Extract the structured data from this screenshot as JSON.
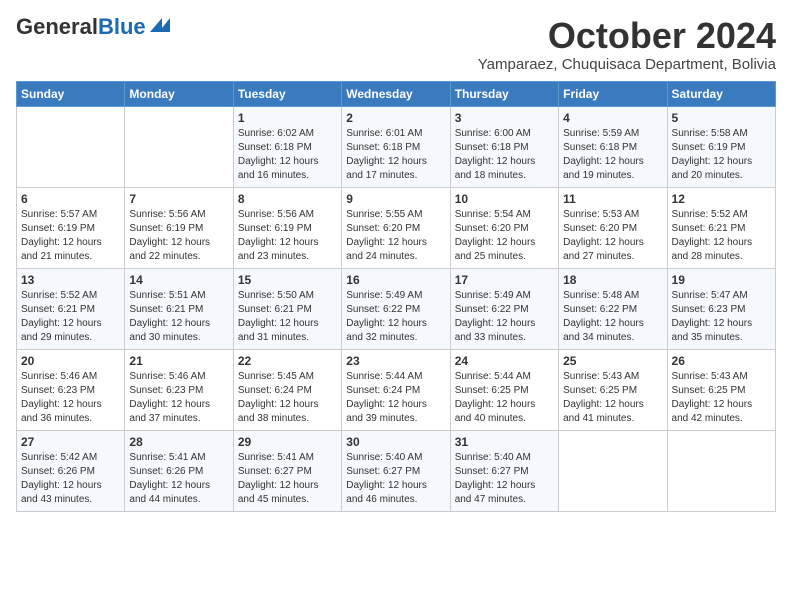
{
  "logo": {
    "part1": "General",
    "part2": "Blue"
  },
  "title": "October 2024",
  "subtitle": "Yamparaez, Chuquisaca Department, Bolivia",
  "days_of_week": [
    "Sunday",
    "Monday",
    "Tuesday",
    "Wednesday",
    "Thursday",
    "Friday",
    "Saturday"
  ],
  "weeks": [
    [
      {
        "day": "",
        "info": ""
      },
      {
        "day": "",
        "info": ""
      },
      {
        "day": "1",
        "info": "Sunrise: 6:02 AM\nSunset: 6:18 PM\nDaylight: 12 hours and 16 minutes."
      },
      {
        "day": "2",
        "info": "Sunrise: 6:01 AM\nSunset: 6:18 PM\nDaylight: 12 hours and 17 minutes."
      },
      {
        "day": "3",
        "info": "Sunrise: 6:00 AM\nSunset: 6:18 PM\nDaylight: 12 hours and 18 minutes."
      },
      {
        "day": "4",
        "info": "Sunrise: 5:59 AM\nSunset: 6:18 PM\nDaylight: 12 hours and 19 minutes."
      },
      {
        "day": "5",
        "info": "Sunrise: 5:58 AM\nSunset: 6:19 PM\nDaylight: 12 hours and 20 minutes."
      }
    ],
    [
      {
        "day": "6",
        "info": "Sunrise: 5:57 AM\nSunset: 6:19 PM\nDaylight: 12 hours and 21 minutes."
      },
      {
        "day": "7",
        "info": "Sunrise: 5:56 AM\nSunset: 6:19 PM\nDaylight: 12 hours and 22 minutes."
      },
      {
        "day": "8",
        "info": "Sunrise: 5:56 AM\nSunset: 6:19 PM\nDaylight: 12 hours and 23 minutes."
      },
      {
        "day": "9",
        "info": "Sunrise: 5:55 AM\nSunset: 6:20 PM\nDaylight: 12 hours and 24 minutes."
      },
      {
        "day": "10",
        "info": "Sunrise: 5:54 AM\nSunset: 6:20 PM\nDaylight: 12 hours and 25 minutes."
      },
      {
        "day": "11",
        "info": "Sunrise: 5:53 AM\nSunset: 6:20 PM\nDaylight: 12 hours and 27 minutes."
      },
      {
        "day": "12",
        "info": "Sunrise: 5:52 AM\nSunset: 6:21 PM\nDaylight: 12 hours and 28 minutes."
      }
    ],
    [
      {
        "day": "13",
        "info": "Sunrise: 5:52 AM\nSunset: 6:21 PM\nDaylight: 12 hours and 29 minutes."
      },
      {
        "day": "14",
        "info": "Sunrise: 5:51 AM\nSunset: 6:21 PM\nDaylight: 12 hours and 30 minutes."
      },
      {
        "day": "15",
        "info": "Sunrise: 5:50 AM\nSunset: 6:21 PM\nDaylight: 12 hours and 31 minutes."
      },
      {
        "day": "16",
        "info": "Sunrise: 5:49 AM\nSunset: 6:22 PM\nDaylight: 12 hours and 32 minutes."
      },
      {
        "day": "17",
        "info": "Sunrise: 5:49 AM\nSunset: 6:22 PM\nDaylight: 12 hours and 33 minutes."
      },
      {
        "day": "18",
        "info": "Sunrise: 5:48 AM\nSunset: 6:22 PM\nDaylight: 12 hours and 34 minutes."
      },
      {
        "day": "19",
        "info": "Sunrise: 5:47 AM\nSunset: 6:23 PM\nDaylight: 12 hours and 35 minutes."
      }
    ],
    [
      {
        "day": "20",
        "info": "Sunrise: 5:46 AM\nSunset: 6:23 PM\nDaylight: 12 hours and 36 minutes."
      },
      {
        "day": "21",
        "info": "Sunrise: 5:46 AM\nSunset: 6:23 PM\nDaylight: 12 hours and 37 minutes."
      },
      {
        "day": "22",
        "info": "Sunrise: 5:45 AM\nSunset: 6:24 PM\nDaylight: 12 hours and 38 minutes."
      },
      {
        "day": "23",
        "info": "Sunrise: 5:44 AM\nSunset: 6:24 PM\nDaylight: 12 hours and 39 minutes."
      },
      {
        "day": "24",
        "info": "Sunrise: 5:44 AM\nSunset: 6:25 PM\nDaylight: 12 hours and 40 minutes."
      },
      {
        "day": "25",
        "info": "Sunrise: 5:43 AM\nSunset: 6:25 PM\nDaylight: 12 hours and 41 minutes."
      },
      {
        "day": "26",
        "info": "Sunrise: 5:43 AM\nSunset: 6:25 PM\nDaylight: 12 hours and 42 minutes."
      }
    ],
    [
      {
        "day": "27",
        "info": "Sunrise: 5:42 AM\nSunset: 6:26 PM\nDaylight: 12 hours and 43 minutes."
      },
      {
        "day": "28",
        "info": "Sunrise: 5:41 AM\nSunset: 6:26 PM\nDaylight: 12 hours and 44 minutes."
      },
      {
        "day": "29",
        "info": "Sunrise: 5:41 AM\nSunset: 6:27 PM\nDaylight: 12 hours and 45 minutes."
      },
      {
        "day": "30",
        "info": "Sunrise: 5:40 AM\nSunset: 6:27 PM\nDaylight: 12 hours and 46 minutes."
      },
      {
        "day": "31",
        "info": "Sunrise: 5:40 AM\nSunset: 6:27 PM\nDaylight: 12 hours and 47 minutes."
      },
      {
        "day": "",
        "info": ""
      },
      {
        "day": "",
        "info": ""
      }
    ]
  ]
}
